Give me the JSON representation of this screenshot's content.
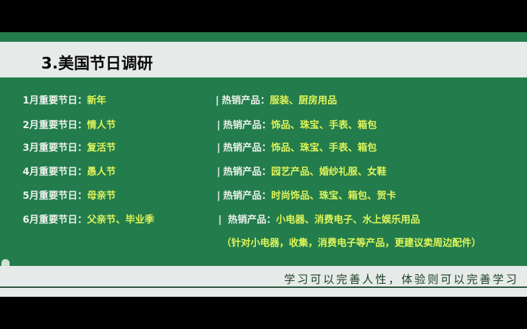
{
  "title": "3.美国节日调研",
  "rows": [
    {
      "label": "1月重要节日：",
      "holiday": "新年",
      "products_label": "热销产品：",
      "products": "服装、厨房用品"
    },
    {
      "label": "2月重要节日：",
      "holiday": "情人节",
      "products_label": "热销产品：",
      "products": "饰品、珠宝、手表、箱包"
    },
    {
      "label": "3月重要节日：",
      "holiday": "复活节",
      "products_label": "热销产品：",
      "products": "饰品、珠宝、手表、箱包"
    },
    {
      "label": "4月重要节日：",
      "holiday": "愚人节",
      "products_label": "热销产品：",
      "products": "园艺产品、婚纱礼服、女鞋"
    },
    {
      "label": "5月重要节日：",
      "holiday": "母亲节",
      "products_label": "热销产品：",
      "products": "时尚饰品、珠宝、箱包、贺卡"
    },
    {
      "label": "6月重要节日：",
      "holiday": "父亲节、毕业季",
      "products_label": "热销产品：",
      "products": "小电器、消费电子、水上娱乐用品"
    }
  ],
  "note": "（针对小电器，收集，消费电子等产品，更建议卖周边配件）",
  "separator": "|",
  "footer": "学习可以完善人性，体验则可以完善学习"
}
